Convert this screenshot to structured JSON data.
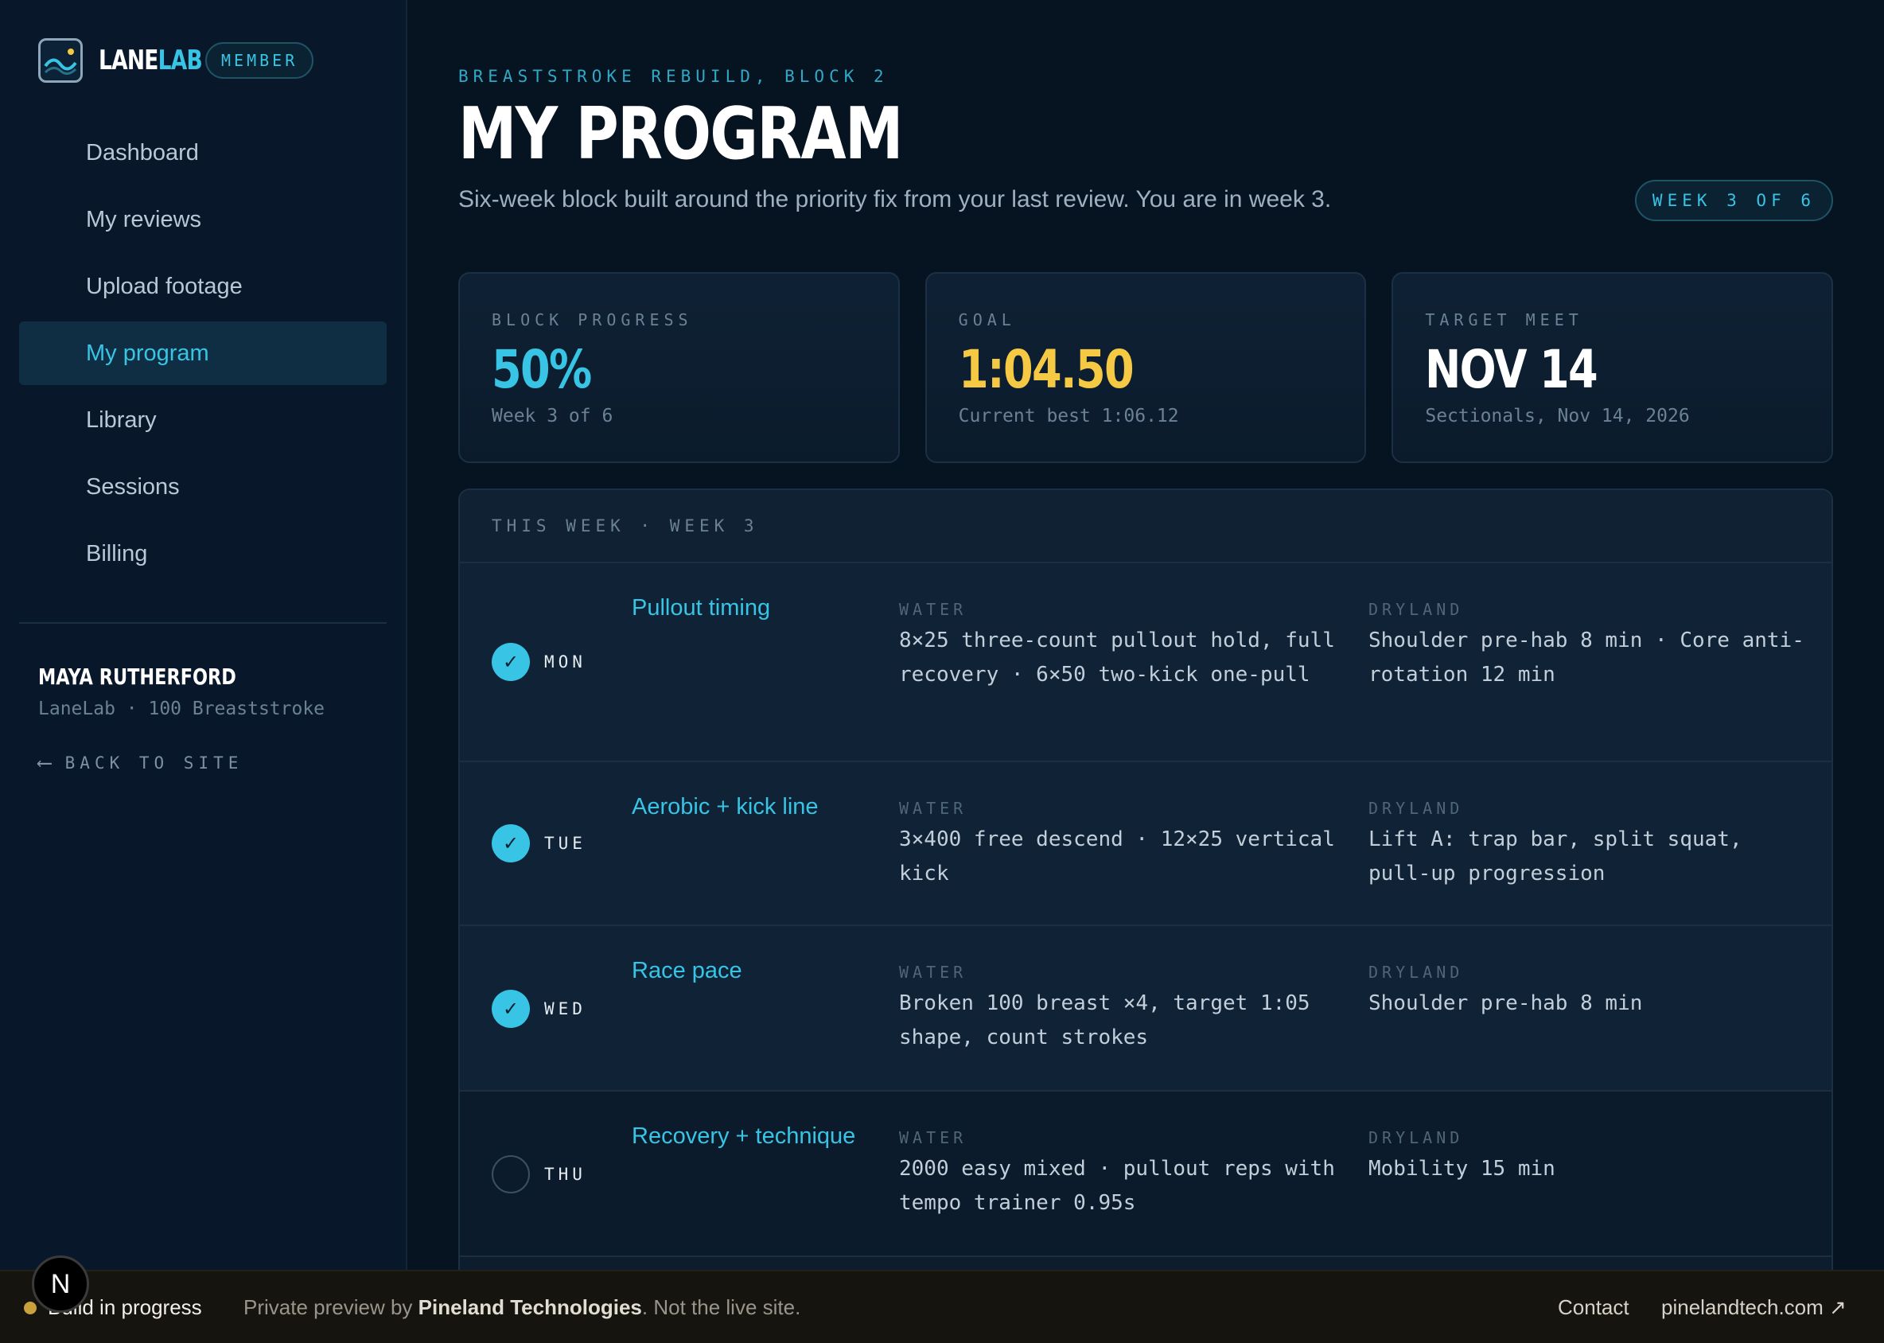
{
  "brand": {
    "name_a": "LANE",
    "name_b": "LAB",
    "badge": "MEMBER",
    "logo_icon": "wave-chart-icon"
  },
  "sidebar": {
    "items": [
      {
        "label": "Dashboard"
      },
      {
        "label": "My reviews"
      },
      {
        "label": "Upload footage"
      },
      {
        "label": "My program",
        "active": true
      },
      {
        "label": "Library"
      },
      {
        "label": "Sessions"
      },
      {
        "label": "Billing"
      }
    ],
    "user_name": "MAYA RUTHERFORD",
    "user_sub": "LaneLab · 100 Breaststroke",
    "back_label": "BACK TO SITE",
    "back_icon": "arrow-left-icon"
  },
  "header": {
    "eyebrow": "BREASTSTROKE REBUILD, BLOCK 2",
    "title": "MY PROGRAM",
    "subtitle": "Six-week block built around the priority fix from your last review. You are in week 3.",
    "week_badge": "WEEK 3 OF 6"
  },
  "cards": [
    {
      "label": "BLOCK PROGRESS",
      "value": "50%",
      "meta": "Week 3 of 6"
    },
    {
      "label": "GOAL",
      "value": "1:04.50",
      "meta": "Current best 1:06.12"
    },
    {
      "label": "TARGET MEET",
      "value": "NOV 14",
      "meta": "Sectionals, Nov 14, 2026"
    }
  ],
  "week": {
    "heading": "THIS WEEK · WEEK 3",
    "water_label": "WATER",
    "dryland_label": "DRYLAND",
    "days": [
      {
        "day": "MON",
        "done": true,
        "title": "Pullout timing",
        "water": "8×25 three-count pullout hold, full recovery · 6×50 two-kick one-pull",
        "dryland": "Shoulder pre-hab 8 min · Core anti-rotation 12 min"
      },
      {
        "day": "TUE",
        "done": true,
        "title": "Aerobic + kick line",
        "water": "3×400 free descend · 12×25 vertical kick",
        "dryland": "Lift A: trap bar, split squat, pull-up progression"
      },
      {
        "day": "WED",
        "done": true,
        "title": "Race pace",
        "water": "Broken 100 breast ×4, target 1:05 shape, count strokes",
        "dryland": "Shoulder pre-hab 8 min"
      },
      {
        "day": "THU",
        "done": false,
        "title": "Recovery + technique",
        "water": "2000 easy mixed · pullout reps with tempo trainer 0.95s",
        "dryland": "Mobility 15 min"
      }
    ]
  },
  "footer": {
    "status": "Build in progress",
    "preview_prefix": "Private preview by ",
    "preview_company": "Pineland Technologies",
    "preview_suffix": ". Not the live site.",
    "contact": "Contact",
    "site": "pinelandtech.com ↗",
    "n_badge": "N"
  },
  "colors": {
    "accent": "#38c4e4",
    "goal": "#f6c944",
    "bg": "#061320",
    "panel": "#0d1d2e"
  }
}
